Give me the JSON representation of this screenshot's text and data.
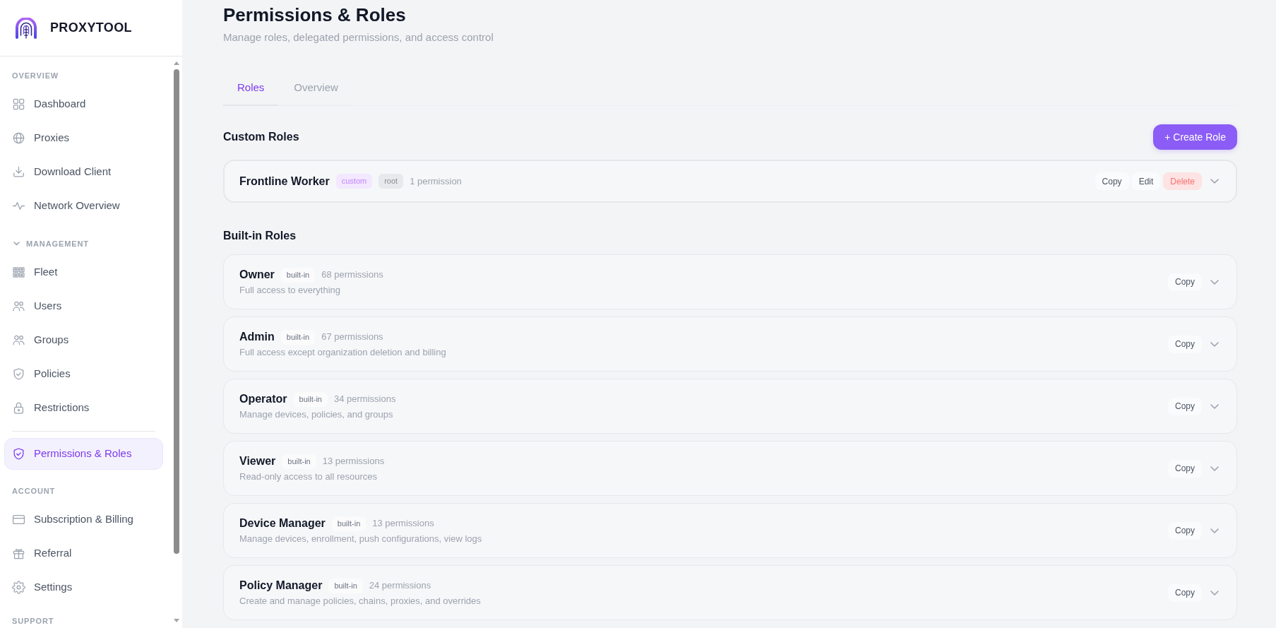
{
  "sidebar": {
    "brand": "PROXYTOOL",
    "sections": [
      {
        "label": "OVERVIEW",
        "items": [
          {
            "label": "Dashboard",
            "selected": false
          },
          {
            "label": "Proxies",
            "selected": false
          },
          {
            "label": "Download Client",
            "selected": false
          },
          {
            "label": "Network Overview",
            "selected": false
          }
        ]
      },
      {
        "label": "MANAGEMENT",
        "expanded": true,
        "items": [
          {
            "label": "Fleet",
            "selected": false
          },
          {
            "label": "Users",
            "selected": false
          },
          {
            "label": "Groups",
            "selected": false
          },
          {
            "label": "Policies",
            "selected": false
          },
          {
            "label": "Restrictions",
            "selected": false
          }
        ]
      },
      {
        "items": [
          {
            "label": "Permissions & Roles",
            "selected": true
          }
        ]
      },
      {
        "label": "ACCOUNT",
        "items": [
          {
            "label": "Subscription & Billing",
            "selected": false
          },
          {
            "label": "Referral",
            "selected": false
          },
          {
            "label": "Settings",
            "selected": false
          }
        ]
      },
      {
        "label": "SUPPORT"
      }
    ]
  },
  "page": {
    "title": "Permissions & Roles",
    "subtitle": "Manage roles, delegated permissions, and access control"
  },
  "tabs": [
    {
      "label": "Roles",
      "selected": true
    },
    {
      "label": "Overview",
      "selected": false
    }
  ],
  "custom_roles": {
    "heading": "Custom Roles",
    "create_button": "+ Create Role",
    "roles": [
      {
        "name": "Frontline Worker",
        "tags": [
          {
            "label": "custom",
            "kind": "custom"
          },
          {
            "label": "root",
            "kind": "scope"
          }
        ],
        "permissions": "1 permission",
        "actions": [
          {
            "label": "Copy",
            "kind": "copy"
          },
          {
            "label": "Edit",
            "kind": "edit"
          },
          {
            "label": "Delete",
            "kind": "delete"
          }
        ]
      }
    ]
  },
  "built_in_roles": {
    "heading": "Built-in Roles",
    "roles": [
      {
        "name": "Owner",
        "tags": [
          {
            "label": "built-in",
            "kind": "builtin"
          }
        ],
        "permissions": "68 permissions",
        "description": "Full access to everything",
        "actions": [
          {
            "label": "Copy",
            "kind": "copy"
          }
        ]
      },
      {
        "name": "Admin",
        "tags": [
          {
            "label": "built-in",
            "kind": "builtin"
          }
        ],
        "permissions": "67 permissions",
        "description": "Full access except organization deletion and billing",
        "actions": [
          {
            "label": "Copy",
            "kind": "copy"
          }
        ]
      },
      {
        "name": "Operator",
        "tags": [
          {
            "label": "built-in",
            "kind": "builtin"
          }
        ],
        "permissions": "34 permissions",
        "description": "Manage devices, policies, and groups",
        "actions": [
          {
            "label": "Copy",
            "kind": "copy"
          }
        ]
      },
      {
        "name": "Viewer",
        "tags": [
          {
            "label": "built-in",
            "kind": "builtin"
          }
        ],
        "permissions": "13 permissions",
        "description": "Read-only access to all resources",
        "actions": [
          {
            "label": "Copy",
            "kind": "copy"
          }
        ]
      },
      {
        "name": "Device Manager",
        "tags": [
          {
            "label": "built-in",
            "kind": "builtin"
          }
        ],
        "permissions": "13 permissions",
        "description": "Manage devices, enrollment, push configurations, view logs",
        "actions": [
          {
            "label": "Copy",
            "kind": "copy"
          }
        ]
      },
      {
        "name": "Policy Manager",
        "tags": [
          {
            "label": "built-in",
            "kind": "builtin"
          }
        ],
        "permissions": "24 permissions",
        "description": "Create and manage policies, chains, proxies, and overrides",
        "actions": [
          {
            "label": "Copy",
            "kind": "copy"
          }
        ]
      }
    ]
  }
}
